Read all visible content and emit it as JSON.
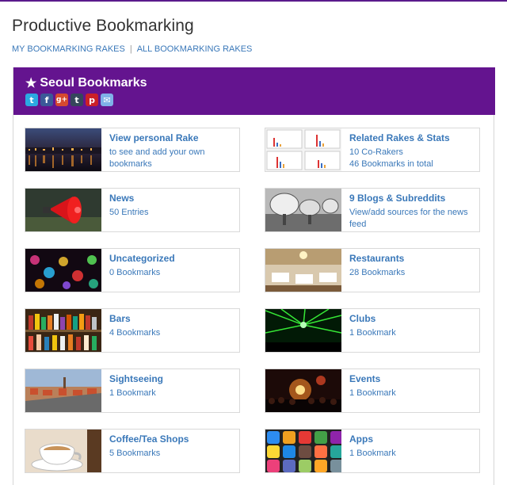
{
  "page": {
    "title": "Productive Bookmarking",
    "nav": [
      "MY BOOKMARKING RAKES",
      "ALL BOOKMARKING RAKES"
    ]
  },
  "panel": {
    "title": "Seoul Bookmarks",
    "social_icons": [
      "twitter-icon",
      "facebook-icon",
      "google-plus-icon",
      "tumblr-icon",
      "pinterest-icon",
      "email-icon"
    ],
    "accent": "#64148f"
  },
  "cards": [
    {
      "title": "View personal Rake",
      "line1": "to see and add your own",
      "line2": "bookmarks",
      "thumb": "night-skyline"
    },
    {
      "title": "Related Rakes & Stats",
      "line1": "10 Co-Rakers",
      "line2": "46 Bookmarks in total",
      "thumb": "charts"
    },
    {
      "title": "News",
      "line1": "50 Entries",
      "line2": "",
      "thumb": "megaphone"
    },
    {
      "title": "9 Blogs & Subreddits",
      "line1": "View/add sources for the news",
      "line2": "feed",
      "thumb": "satellite-dishes"
    },
    {
      "title": "Uncategorized",
      "line1": "0 Bookmarks",
      "line2": "",
      "thumb": "bokeh-lights"
    },
    {
      "title": "Restaurants",
      "line1": "28 Bookmarks",
      "line2": "",
      "thumb": "dining-hall"
    },
    {
      "title": "Bars",
      "line1": "4 Bookmarks",
      "line2": "",
      "thumb": "bottles"
    },
    {
      "title": "Clubs",
      "line1": "1 Bookmark",
      "line2": "",
      "thumb": "lasers"
    },
    {
      "title": "Sightseeing",
      "line1": "1 Bookmark",
      "line2": "",
      "thumb": "old-town"
    },
    {
      "title": "Events",
      "line1": "1 Bookmark",
      "line2": "",
      "thumb": "concert"
    },
    {
      "title": "Coffee/Tea Shops",
      "line1": "5 Bookmarks",
      "line2": "",
      "thumb": "coffee-cup"
    },
    {
      "title": "Apps",
      "line1": "1 Bookmark",
      "line2": "",
      "thumb": "app-icons"
    }
  ]
}
